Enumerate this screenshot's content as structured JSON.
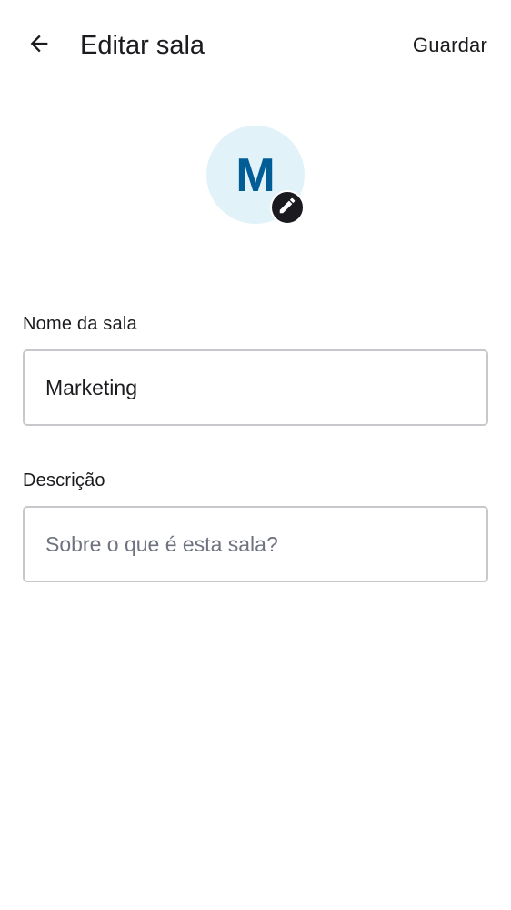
{
  "header": {
    "title": "Editar sala",
    "save_label": "Guardar",
    "back_icon": "arrow-left-icon"
  },
  "avatar": {
    "letter": "M",
    "background_color": "#e1f3f9",
    "letter_color": "#005d96",
    "edit_icon": "pencil-icon"
  },
  "form": {
    "name_label": "Nome da sala",
    "name_value": "Marketing",
    "description_label": "Descrição",
    "description_value": "",
    "description_placeholder": "Sobre o que é esta sala?"
  }
}
